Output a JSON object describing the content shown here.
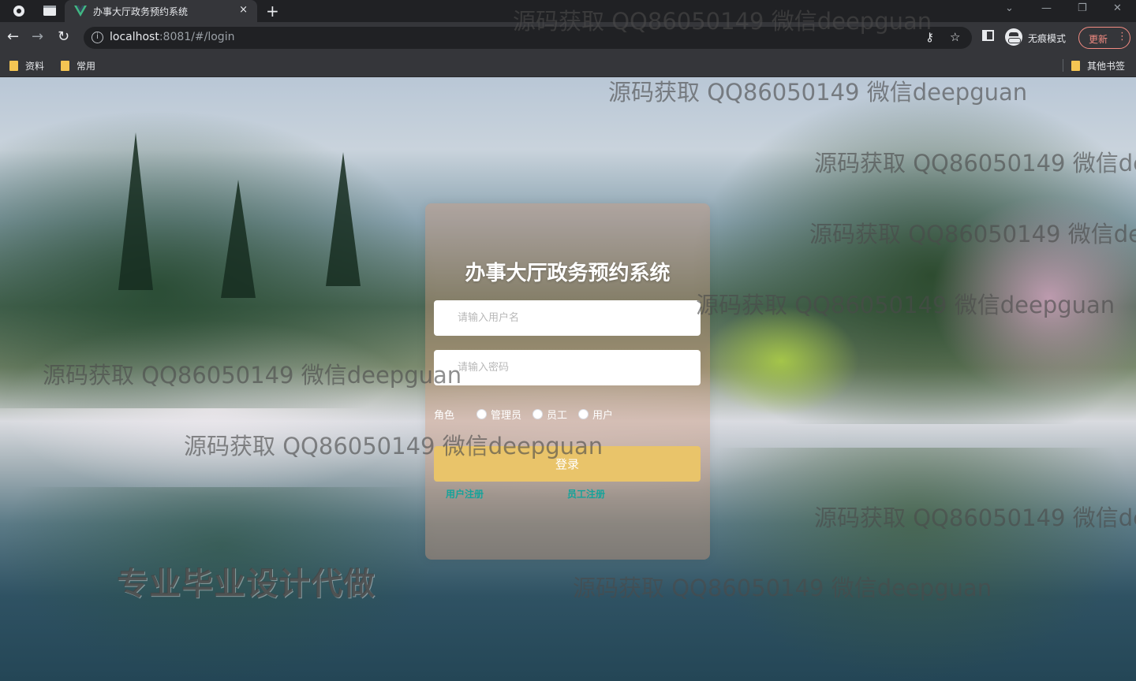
{
  "browser": {
    "tab_title": "办事大厅政务预约系统",
    "tab_close": "×",
    "new_tab": "+",
    "url_host": "localhost",
    "url_rest": ":8081/#/login",
    "incognito_label": "无痕模式",
    "update_label": "更新",
    "bookmarks": [
      "资料",
      "常用"
    ],
    "other_bookmarks": "其他书签",
    "icons": [
      "globe-icon",
      "tab-strip-icon",
      "vue-favicon-icon",
      "back-icon",
      "forward-icon",
      "reload-icon",
      "info-icon",
      "key-icon",
      "star-icon",
      "side-panel-icon",
      "incognito-icon",
      "menu-dots-icon",
      "folder-icon"
    ]
  },
  "login": {
    "title": "办事大厅政务预约系统",
    "username_placeholder": "请输入用户名",
    "password_placeholder": "请输入密码",
    "role_label": "角色",
    "roles": [
      "管理员",
      "员工",
      "用户"
    ],
    "submit_label": "登录",
    "register_user": "用户注册",
    "register_staff": "员工注册"
  },
  "overlay": {
    "watermark": "源码获取 QQ86050149 微信deepguan",
    "promo": "专业毕业设计代做"
  },
  "colors": {
    "accent_button": "#e9c46a",
    "link": "#16a39a",
    "update_border": "#f28b82"
  }
}
